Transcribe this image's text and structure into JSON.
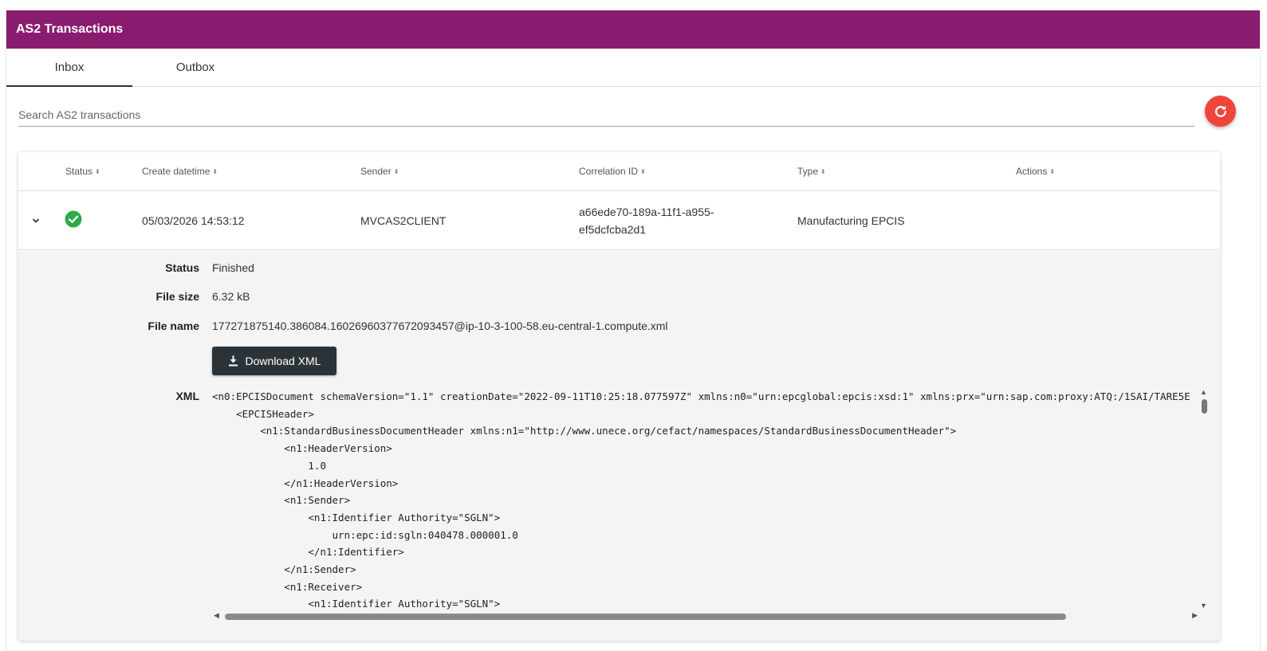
{
  "title": "AS2 Transactions",
  "tabs": [
    {
      "label": "Inbox",
      "active": true
    },
    {
      "label": "Outbox",
      "active": false
    }
  ],
  "search": {
    "placeholder": "Search AS2 transactions",
    "value": ""
  },
  "refresh_icon": "refresh-icon",
  "colors": {
    "header": "#8a1c6f",
    "refresh": "#f0453a",
    "success": "#2eaa47",
    "button": "#2c3338"
  },
  "table": {
    "columns": [
      "Status",
      "Create datetime",
      "Sender",
      "Correlation ID",
      "Type",
      "Actions"
    ],
    "rows": [
      {
        "status_icon": "check-circle-icon",
        "create_datetime": "05/03/2026 14:53:12",
        "sender": "MVCAS2CLIENT",
        "correlation_id_line1": "a66ede70-189a-11f1-a955-",
        "correlation_id_line2": "ef5dcfcba2d1",
        "type": "Manufacturing EPCIS",
        "expanded": true
      }
    ]
  },
  "detail": {
    "status_label": "Status",
    "status_value": "Finished",
    "file_size_label": "File size",
    "file_size_value": "6.32 kB",
    "file_name_label": "File name",
    "file_name_value": "177271875140.386084.16026960377672093457@ip-10-3-100-58.eu-central-1.compute.xml",
    "download_label": "Download XML",
    "xml_label": "XML",
    "xml_lines": [
      "<n0:EPCISDocument schemaVersion=\"1.1\" creationDate=\"2022-09-11T10:25:18.077597Z\" xmlns:n0=\"urn:epcglobal:epcis:xsd:1\" xmlns:prx=\"urn:sap.com:proxy:ATQ:/1SAI/TARE5E",
      "    <EPCISHeader>",
      "        <n1:StandardBusinessDocumentHeader xmlns:n1=\"http://www.unece.org/cefact/namespaces/StandardBusinessDocumentHeader\">",
      "            <n1:HeaderVersion>",
      "                1.0",
      "            </n1:HeaderVersion>",
      "            <n1:Sender>",
      "                <n1:Identifier Authority=\"SGLN\">",
      "                    urn:epc:id:sgln:040478.000001.0",
      "                </n1:Identifier>",
      "            </n1:Sender>",
      "            <n1:Receiver>",
      "                <n1:Identifier Authority=\"SGLN\">"
    ]
  }
}
